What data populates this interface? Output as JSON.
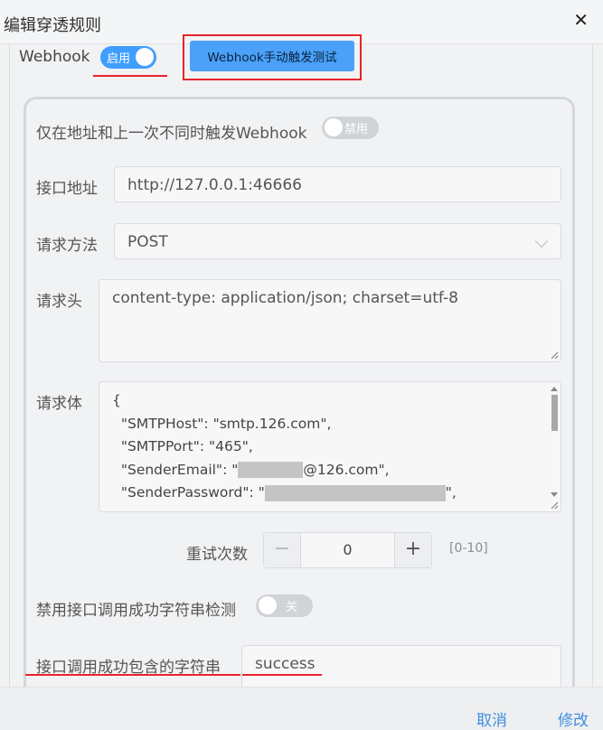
{
  "dialog": {
    "title": "编辑穿透规则",
    "close_icon": "close-icon"
  },
  "webhook": {
    "label": "Webhook",
    "toggle_text": "启用",
    "toggle_on": true,
    "test_button": "Webhook手动触发测试"
  },
  "form": {
    "trigger_on_change": {
      "label": "仅在地址和上一次不同时触发Webhook",
      "toggle_text": "禁用",
      "toggle_on": false
    },
    "url": {
      "label": "接口地址",
      "value": "http://127.0.0.1:46666"
    },
    "method": {
      "label": "请求方法",
      "value": "POST"
    },
    "headers": {
      "label": "请求头",
      "value": "content-type: application/json; charset=utf-8"
    },
    "body": {
      "label": "请求体",
      "lines": [
        "{",
        "  \"SMTPHost\": \"smtp.126.com\",",
        "  \"SMTPPort\": \"465\","
      ],
      "email_prefix": "  \"SenderEmail\": \"",
      "email_suffix": "@126.com\",",
      "password_prefix": "  \"SenderPassword\": \"",
      "password_suffix": "\","
    },
    "retry": {
      "label": "重试次数",
      "value": "0",
      "range": "[0-10]"
    },
    "disable_success_check": {
      "label": "禁用接口调用成功字符串检测",
      "toggle_text": "关",
      "toggle_on": false
    },
    "success_string": {
      "label": "接口调用成功包含的字符串",
      "value": "success"
    }
  },
  "footer": {
    "cancel": "取消",
    "modify": "修改"
  },
  "colors": {
    "accent": "#409eff",
    "highlight": "#e8242a"
  }
}
